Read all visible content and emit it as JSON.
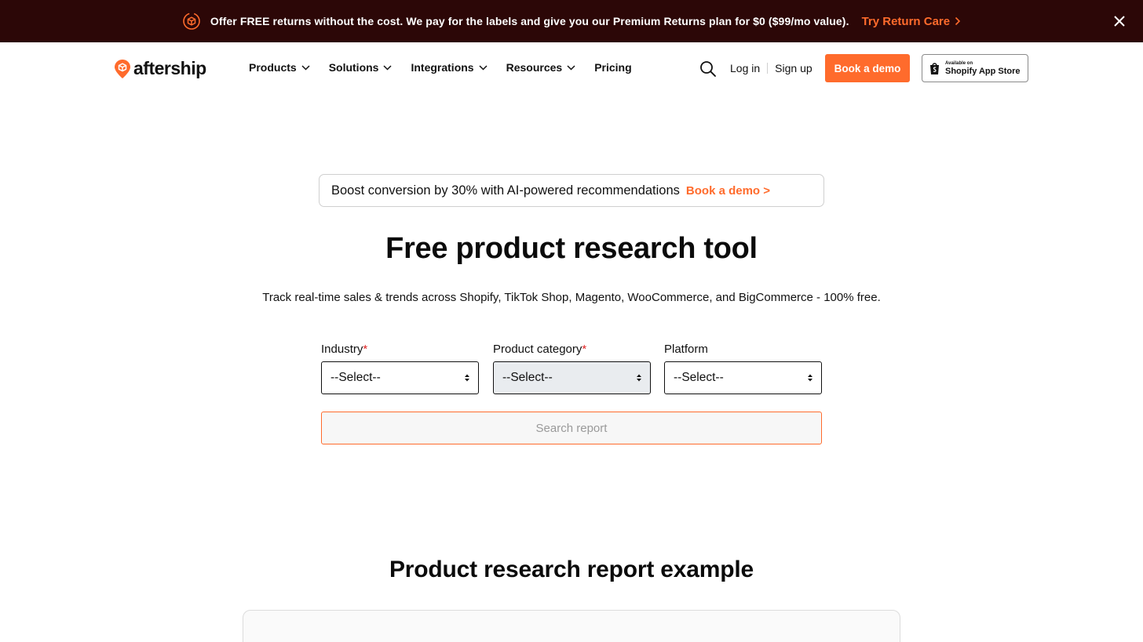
{
  "announcement": {
    "message": "Offer FREE returns without the cost. We pay for the labels and give you our Premium Returns plan for $0 ($99/mo value).",
    "cta": "Try Return Care",
    "icon": "return-box-icon",
    "accent": "#ff6b2c",
    "background": "#2c0707"
  },
  "nav": {
    "logo_text": "aftership",
    "menu": [
      {
        "label": "Products",
        "has_dropdown": true
      },
      {
        "label": "Solutions",
        "has_dropdown": true
      },
      {
        "label": "Integrations",
        "has_dropdown": true
      },
      {
        "label": "Resources",
        "has_dropdown": true
      },
      {
        "label": "Pricing",
        "has_dropdown": false
      }
    ],
    "login": "Log in",
    "signup": "Sign up",
    "book_demo": "Book a demo",
    "shopify_badge": {
      "small": "Available on",
      "big": "Shopify App Store"
    }
  },
  "promo": {
    "text": "Boost conversion by 30% with AI-powered recommendations",
    "link": "Book a demo >"
  },
  "hero": {
    "title": "Free product research tool",
    "subtitle": "Track real-time sales & trends across Shopify, TikTok Shop, Magento, WooCommerce, and BigCommerce - 100% free."
  },
  "form": {
    "fields": [
      {
        "label": "Industry",
        "required": true,
        "value": "--Select--",
        "disabled": false
      },
      {
        "label": "Product category",
        "required": true,
        "value": "--Select--",
        "disabled": true
      },
      {
        "label": "Platform",
        "required": false,
        "value": "--Select--",
        "disabled": false
      }
    ],
    "required_mark": "*",
    "submit": "Search report"
  },
  "report_section": {
    "title": "Product research report example"
  }
}
